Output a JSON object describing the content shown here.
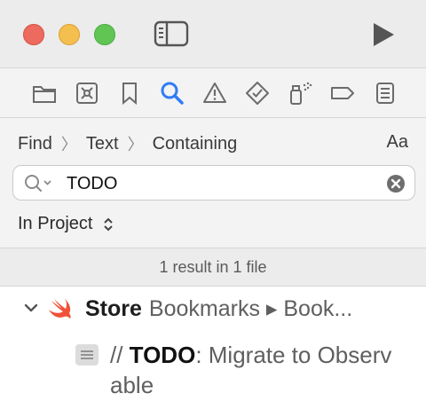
{
  "toolbar": {
    "nav_icons": [
      "folder-icon",
      "source-control-icon",
      "bookmark-icon",
      "find-icon",
      "issue-warning-icon",
      "test-diamond-icon",
      "debug-spray-icon",
      "breakpoint-tag-icon",
      "report-list-icon"
    ],
    "active_nav": "find-icon",
    "accent": "#2f7cf6"
  },
  "find": {
    "breadcrumb": [
      "Find",
      "Text",
      "Containing"
    ],
    "case_toggle": "Aa",
    "query": "TODO",
    "scope": "In Project"
  },
  "summary": "1 result in 1 file",
  "results": {
    "file_name": "Store",
    "file_path": "Bookmarks ▸ Book...",
    "match_prefix": "// ",
    "match_highlight": "TODO",
    "match_suffix": ": Migrate to Observable"
  }
}
